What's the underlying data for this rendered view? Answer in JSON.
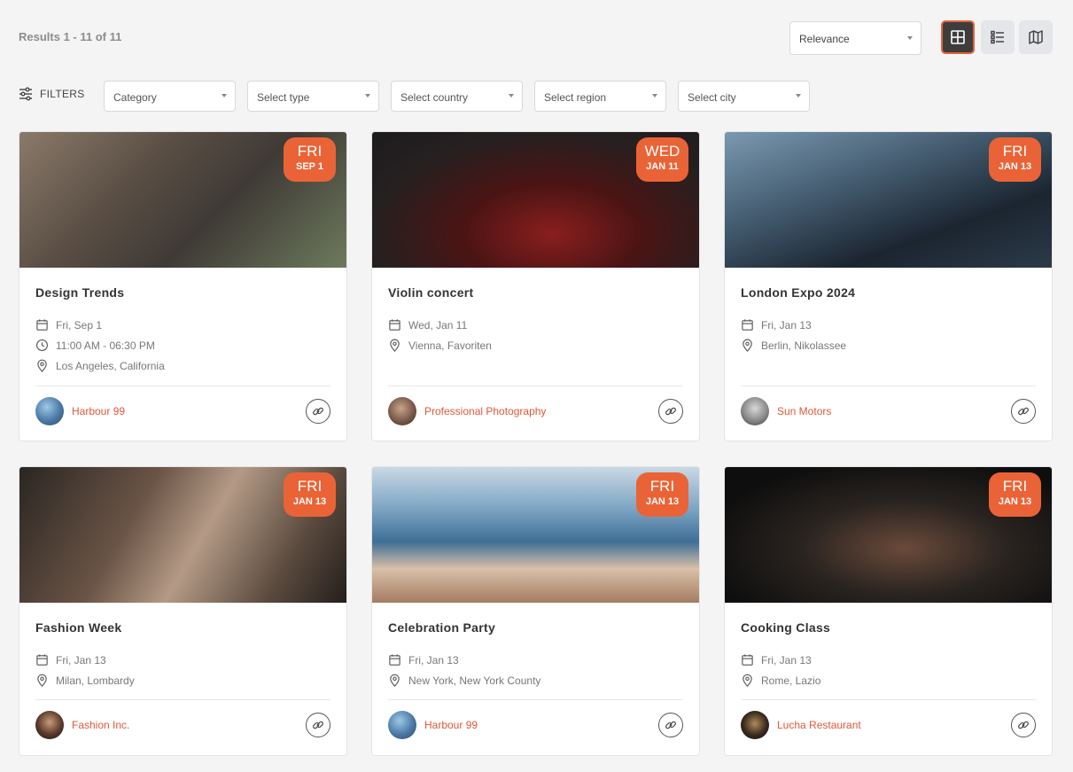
{
  "toolbar": {
    "results": "Results 1 - 11 of 11",
    "sort_value": "Relevance",
    "views": [
      "grid-view",
      "list-view",
      "map-view"
    ],
    "active_view": "grid-view"
  },
  "filters": {
    "label": "FILTERS",
    "selects": [
      "Category",
      "Select type",
      "Select country",
      "Select region",
      "Select city"
    ]
  },
  "colors": {
    "accent": "#ea6336",
    "link": "#e0573a",
    "active_view_bg": "#3d3d3d"
  },
  "events": [
    {
      "title": "Design Trends",
      "badge_dow": "FRI",
      "badge_md": "SEP 1",
      "date": "Fri, Sep 1",
      "time": "11:00 AM - 06:30 PM",
      "location": "Los Angeles, California",
      "organizer": "Harbour 99"
    },
    {
      "title": "Violin concert",
      "badge_dow": "WED",
      "badge_md": "JAN 11",
      "date": "Wed, Jan 11",
      "time": "",
      "location": "Vienna, Favoriten",
      "organizer": "Professional Photography"
    },
    {
      "title": "London Expo 2024",
      "badge_dow": "FRI",
      "badge_md": "JAN 13",
      "date": "Fri, Jan 13",
      "time": "",
      "location": "Berlin, Nikolassee",
      "organizer": "Sun Motors"
    },
    {
      "title": "Fashion Week",
      "badge_dow": "FRI",
      "badge_md": "JAN 13",
      "date": "Fri, Jan 13",
      "time": "",
      "location": "Milan, Lombardy",
      "organizer": "Fashion Inc."
    },
    {
      "title": "Celebration Party",
      "badge_dow": "FRI",
      "badge_md": "JAN 13",
      "date": "Fri, Jan 13",
      "time": "",
      "location": "New York, New York County",
      "organizer": "Harbour 99"
    },
    {
      "title": "Cooking Class",
      "badge_dow": "FRI",
      "badge_md": "JAN 13",
      "date": "Fri, Jan 13",
      "time": "",
      "location": "Rome, Lazio",
      "organizer": "Lucha Restaurant"
    }
  ]
}
